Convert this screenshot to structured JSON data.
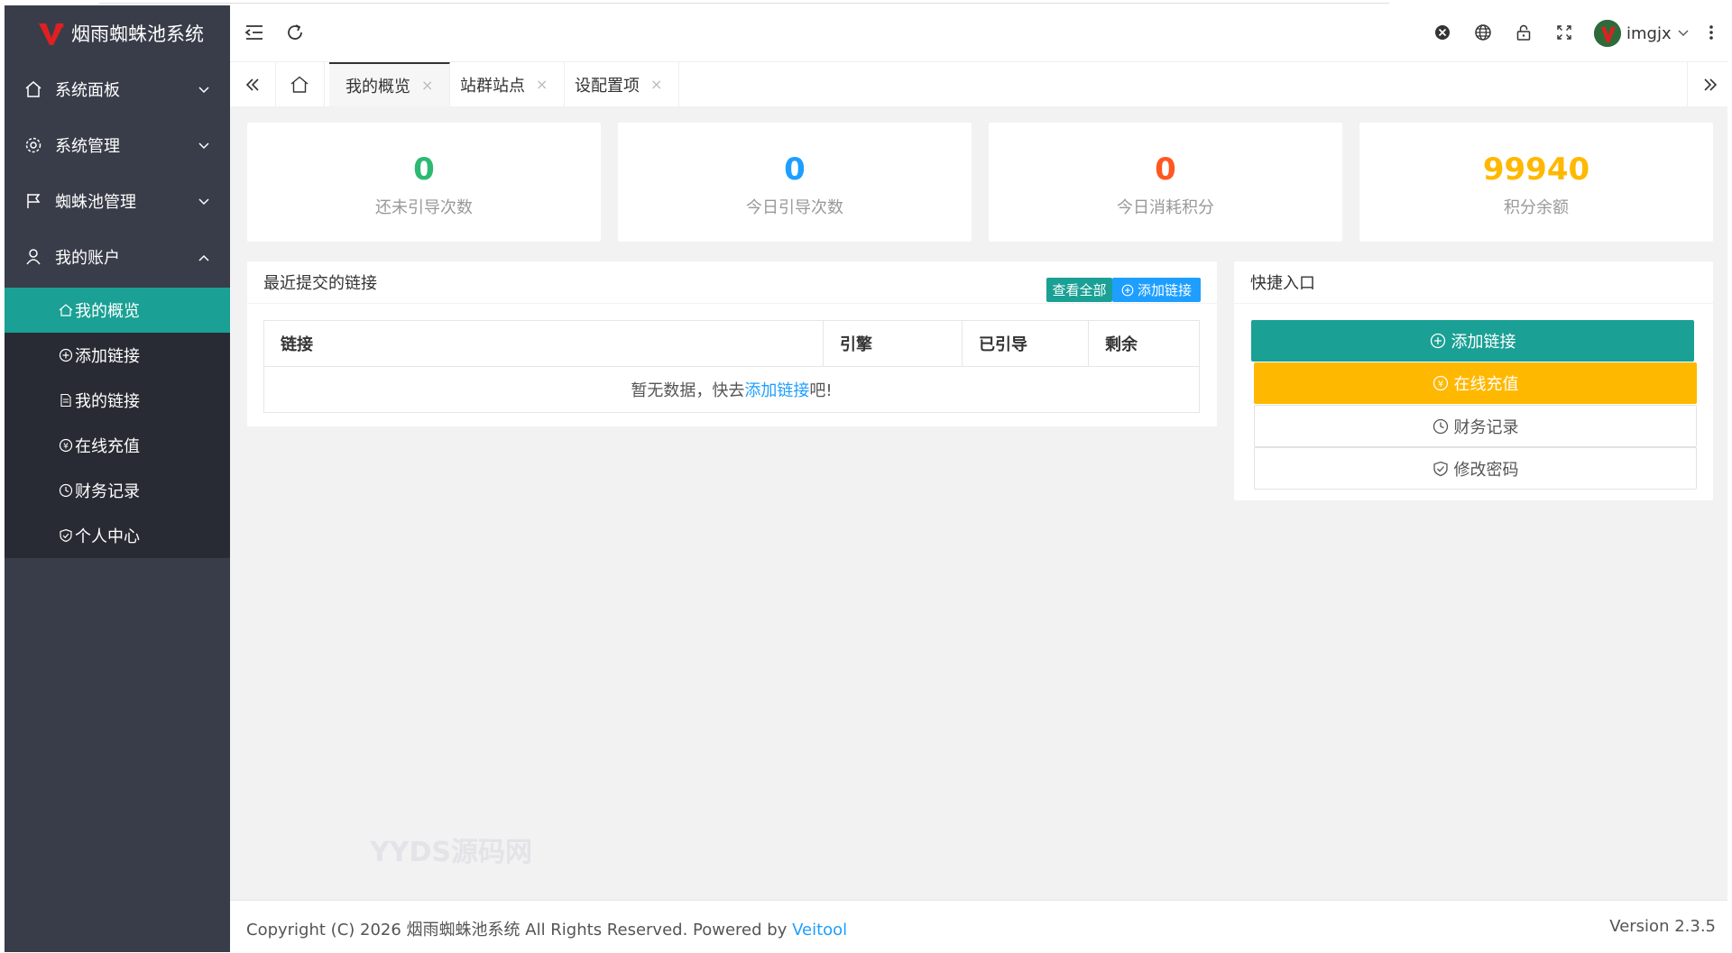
{
  "brand": {
    "title": "烟雨蜘蛛池系统"
  },
  "sidebar": {
    "items": [
      {
        "label": "系统面板",
        "icon": "home-icon"
      },
      {
        "label": "系统管理",
        "icon": "gear-icon"
      },
      {
        "label": "蜘蛛池管理",
        "icon": "flag-icon"
      },
      {
        "label": "我的账户",
        "icon": "user-icon"
      }
    ],
    "sub_items": [
      {
        "label": "我的概览",
        "icon": "home-icon"
      },
      {
        "label": "添加链接",
        "icon": "plus-circle-icon"
      },
      {
        "label": "我的链接",
        "icon": "file-icon"
      },
      {
        "label": "在线充值",
        "icon": "yen-circle-icon"
      },
      {
        "label": "财务记录",
        "icon": "clock-icon"
      },
      {
        "label": "个人中心",
        "icon": "shield-check-icon"
      }
    ]
  },
  "topbar": {
    "username": "imgjx"
  },
  "tabs": [
    {
      "label": "我的概览",
      "active": true
    },
    {
      "label": "站群站点",
      "active": false
    },
    {
      "label": "设配置项",
      "active": false
    }
  ],
  "stats": [
    {
      "value": "0",
      "label": "还未引导次数",
      "color": "#2eb872"
    },
    {
      "value": "0",
      "label": "今日引导次数",
      "color": "#1e9fff"
    },
    {
      "value": "0",
      "label": "今日消耗积分",
      "color": "#ff5722"
    },
    {
      "value": "99940",
      "label": "积分余额",
      "color": "#ffb800"
    }
  ],
  "recent": {
    "title": "最近提交的链接",
    "view_all": "查看全部",
    "add_link": "添加链接",
    "columns": [
      "链接",
      "引擎",
      "已引导",
      "剩余"
    ],
    "empty_prefix": "暂无数据，快去",
    "empty_link": "添加链接",
    "empty_suffix": "吧!"
  },
  "quick": {
    "title": "快捷入口",
    "buttons": [
      {
        "label": "添加链接",
        "icon": "plus-circle-icon"
      },
      {
        "label": "在线充值",
        "icon": "yen-circle-icon"
      },
      {
        "label": "财务记录",
        "icon": "clock-icon"
      },
      {
        "label": "修改密码",
        "icon": "shield-check-icon"
      }
    ]
  },
  "footer": {
    "copyright": "Copyright (C) 2026 烟雨蜘蛛池系统 All Rights Reserved. Powered by ",
    "powered_link": "Veitool",
    "version": "Version 2.3.5"
  },
  "watermark": "YYDS源码网",
  "colors": {
    "sidebar": "#393d49",
    "sidebar_sub": "#282b33",
    "accent": "#1aa094",
    "warn": "#ffb800",
    "blue": "#1e9fff"
  }
}
